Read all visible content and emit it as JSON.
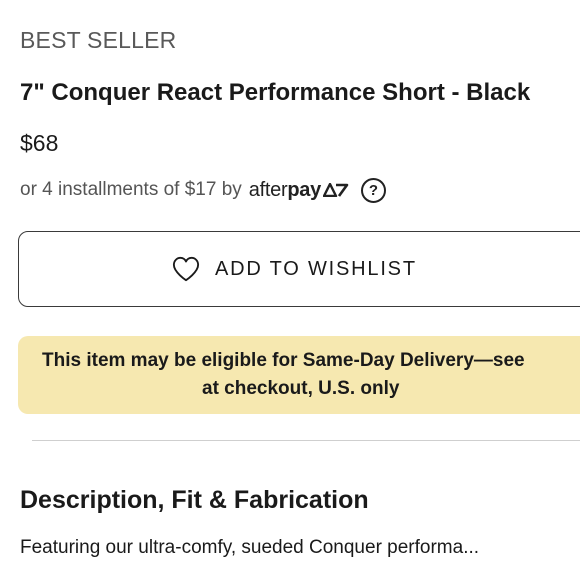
{
  "product": {
    "badge": "BEST SELLER",
    "title": "7\" Conquer React Performance Short - Black",
    "price": "$68"
  },
  "payment": {
    "installments_text": "or 4 installments of $17 by",
    "provider_light": "after",
    "provider_bold": "pay",
    "help_symbol": "?"
  },
  "wishlist": {
    "label": "ADD TO WISHLIST",
    "icon": "heart-outline-icon"
  },
  "delivery": {
    "line1": "This item may be eligible for Same-Day Delivery—see",
    "line2": "at checkout, U.S. only",
    "background_color": "#f6e8b0"
  },
  "description": {
    "heading": "Description, Fit & Fabrication",
    "text": "Featuring our ultra-comfy, sueded Conquer performa..."
  }
}
